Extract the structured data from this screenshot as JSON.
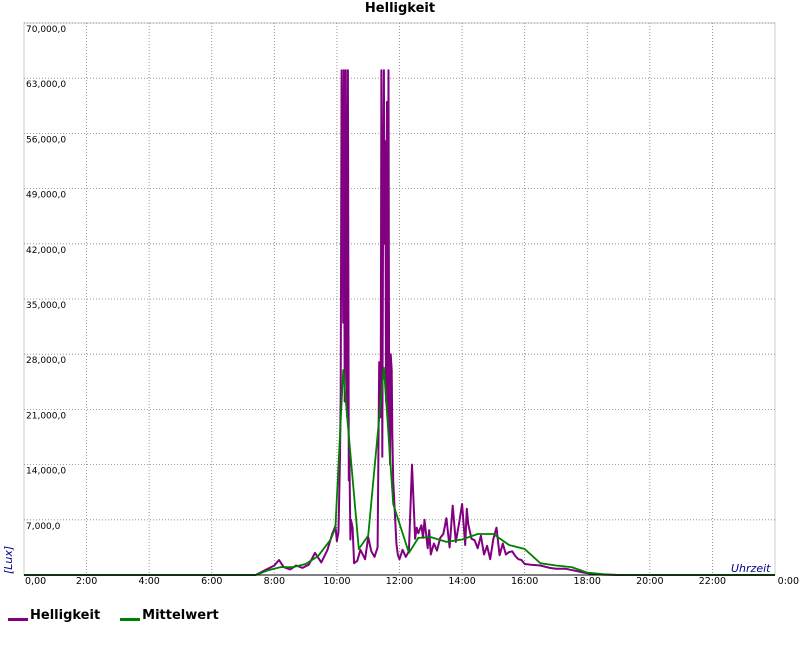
{
  "chart_data": {
    "type": "line",
    "title": "Helligkeit",
    "xlabel": "Uhrzeit",
    "ylabel": "[Lux]",
    "xlim": [
      0,
      24
    ],
    "ylim": [
      0,
      70000
    ],
    "grid": true,
    "legend_placement": "bottom-left",
    "x_ticks": [
      "0,00",
      "2:00",
      "4:00",
      "6:00",
      "8:00",
      "10:00",
      "12:00",
      "14:00",
      "16:00",
      "18:00",
      "20:00",
      "22:00",
      "0:00"
    ],
    "y_ticks": [
      "70,000,0",
      "63,000,0",
      "56,000,0",
      "49,000,0",
      "42,000,0",
      "35,000,0",
      "28,000,0",
      "21,000,0",
      "14,000,0",
      "7,000,0"
    ],
    "series": [
      {
        "name": "Helligkeit",
        "color": "#800080",
        "x": [
          0,
          7.4,
          7.7,
          8.0,
          8.15,
          8.3,
          8.5,
          8.7,
          8.9,
          9.1,
          9.3,
          9.5,
          9.7,
          9.85,
          9.95,
          10.0,
          10.05,
          10.1,
          10.12,
          10.15,
          10.2,
          10.22,
          10.25,
          10.28,
          10.3,
          10.33,
          10.35,
          10.38,
          10.4,
          10.43,
          10.45,
          10.5,
          10.55,
          10.65,
          10.75,
          10.9,
          11.0,
          11.1,
          11.2,
          11.3,
          11.35,
          11.4,
          11.42,
          11.45,
          11.48,
          11.5,
          11.52,
          11.55,
          11.57,
          11.6,
          11.62,
          11.65,
          11.67,
          11.7,
          11.72,
          11.75,
          11.77,
          11.8,
          11.85,
          11.9,
          11.95,
          12.0,
          12.1,
          12.2,
          12.3,
          12.4,
          12.5,
          12.55,
          12.6,
          12.7,
          12.75,
          12.8,
          12.9,
          12.95,
          13.0,
          13.1,
          13.2,
          13.3,
          13.4,
          13.5,
          13.6,
          13.7,
          13.8,
          13.9,
          14.0,
          14.1,
          14.15,
          14.2,
          14.3,
          14.4,
          14.5,
          14.6,
          14.7,
          14.8,
          14.9,
          15.0,
          15.1,
          15.2,
          15.3,
          15.4,
          15.5,
          15.6,
          15.7,
          15.8,
          15.9,
          16.0,
          16.2,
          16.5,
          16.8,
          17.0,
          17.3,
          17.6,
          17.9,
          18.2,
          18.5,
          19.0,
          24.0
        ],
        "values": [
          0,
          0,
          600,
          1200,
          1900,
          1000,
          700,
          1200,
          900,
          1300,
          2800,
          1600,
          3200,
          5200,
          6200,
          4300,
          5500,
          15000,
          23000,
          64000,
          32000,
          64000,
          22000,
          64000,
          35000,
          20000,
          64000,
          12000,
          15000,
          4500,
          7000,
          6000,
          1500,
          1800,
          3200,
          2000,
          4800,
          3000,
          2300,
          3500,
          27000,
          20000,
          64000,
          15000,
          50000,
          64000,
          42000,
          55000,
          22000,
          60000,
          20000,
          64000,
          18000,
          14000,
          28000,
          26000,
          18000,
          12000,
          8000,
          4000,
          2500,
          2000,
          3200,
          2300,
          3000,
          14000,
          4600,
          6000,
          5300,
          6300,
          4700,
          7000,
          3400,
          5700,
          2600,
          4000,
          3100,
          4700,
          5200,
          7200,
          3500,
          8800,
          4200,
          6500,
          9000,
          3800,
          8400,
          6400,
          4600,
          4400,
          3400,
          5000,
          2600,
          3700,
          2000,
          4600,
          6000,
          2500,
          4000,
          2600,
          2900,
          3000,
          2400,
          2000,
          1900,
          1400,
          1300,
          1200,
          900,
          800,
          800,
          550,
          300,
          100,
          50,
          0,
          0
        ]
      },
      {
        "name": "Mittelwert",
        "color": "#008000",
        "x": [
          0,
          7.4,
          7.8,
          8.2,
          8.6,
          9.0,
          9.4,
          9.8,
          9.95,
          10.2,
          10.35,
          10.7,
          11.0,
          11.5,
          11.8,
          12.3,
          12.6,
          13.0,
          13.5,
          14.0,
          14.5,
          15.0,
          15.5,
          16.0,
          16.5,
          17.0,
          17.5,
          18.0,
          18.5,
          19.0,
          24.0
        ],
        "values": [
          0,
          0,
          600,
          1000,
          1000,
          1400,
          2400,
          4500,
          6000,
          26000,
          19000,
          3300,
          5000,
          26300,
          9000,
          2800,
          4700,
          4800,
          4200,
          4500,
          5200,
          5200,
          3800,
          3300,
          1500,
          1200,
          1000,
          300,
          100,
          0,
          0
        ]
      }
    ]
  }
}
